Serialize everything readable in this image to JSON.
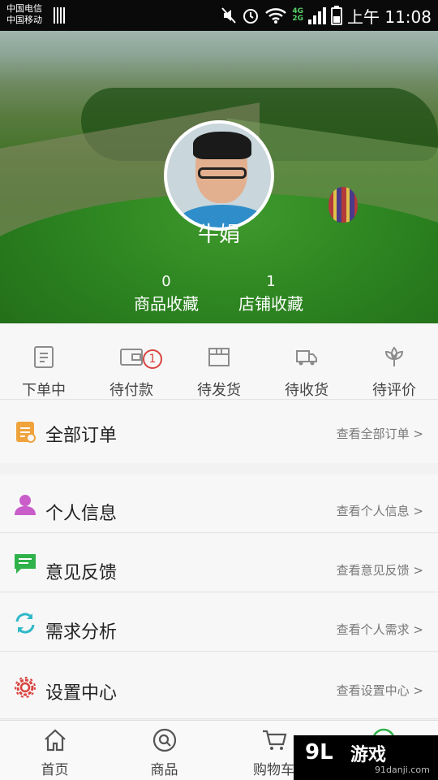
{
  "status_bar": {
    "carrier1": "中国电信",
    "carrier2": "中国移动",
    "net_4g": "4G",
    "net_2g": "2G",
    "time": "上午 11:08"
  },
  "profile": {
    "name": "牛娟",
    "stats": [
      {
        "count": "0",
        "label": "商品收藏"
      },
      {
        "count": "1",
        "label": "店铺收藏"
      }
    ]
  },
  "order_tabs": [
    {
      "label": "下单中",
      "icon": "clipboard-icon"
    },
    {
      "label": "待付款",
      "icon": "wallet-icon",
      "badge": "1"
    },
    {
      "label": "待发货",
      "icon": "box-icon"
    },
    {
      "label": "待收货",
      "icon": "truck-icon"
    },
    {
      "label": "待评价",
      "icon": "flower-icon"
    }
  ],
  "all_orders": {
    "title": "全部订单",
    "link": "查看全部订单 >",
    "icon": "order-list-icon",
    "color": "#f0a23c"
  },
  "menu": [
    {
      "title": "个人信息",
      "link": "查看个人信息 >",
      "icon": "person-icon",
      "color": "#c95dc9"
    },
    {
      "title": "意见反馈",
      "link": "查看意见反馈 >",
      "icon": "chat-icon",
      "color": "#2fb24a"
    },
    {
      "title": "需求分析",
      "link": "查看个人需求 >",
      "icon": "refresh-icon",
      "color": "#2fb8c8"
    },
    {
      "title": "设置中心",
      "link": "查看设置中心 >",
      "icon": "gear-icon",
      "color": "#d9433f"
    }
  ],
  "bottom_nav": [
    {
      "label": "首页",
      "icon": "home-icon"
    },
    {
      "label": "商品",
      "icon": "search-icon"
    },
    {
      "label": "购物车",
      "icon": "cart-icon"
    },
    {
      "label": "",
      "icon": "user-icon"
    }
  ],
  "watermark": {
    "big": "游戏",
    "logo": "9L",
    "small": "91danji.com"
  }
}
